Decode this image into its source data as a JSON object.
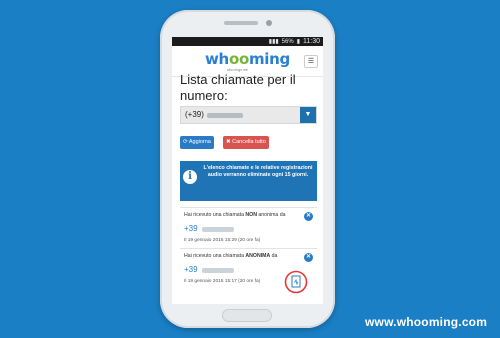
{
  "statusbar": {
    "battery": "56%",
    "time": "11:30"
  },
  "header": {
    "logo_text_1": "wh",
    "logo_text_2": "oo",
    "logo_text_3": "ming",
    "tagline": "who rings me",
    "menu_icon": "hamburger-icon"
  },
  "main": {
    "title": "Lista chiamate per il numero:",
    "phone_prefix": "(+39)",
    "dropdown_icon": "caret-down-icon",
    "update_label": "Aggiorna",
    "clear_label": "Cancella tutto",
    "info_text": "L'elenco chiamate e le relative registrazioni audio verranno eliminate ogni 15 giorni.",
    "calls": [
      {
        "headline": "Hai ricevuto una chiamata NON anonima da",
        "number_prefix": "+39",
        "date": "Il 19 gennaio 2015 15:29 (20 ore fa)"
      },
      {
        "headline": "Hai ricevuto una chiamata ANONIMA da",
        "number_prefix": "+39",
        "date": "Il 19 gennaio 2015 15:17 (20 ore fa)"
      }
    ]
  },
  "footer": {
    "brand": "www.whooming.com"
  },
  "colors": {
    "background": "#1a7fc4",
    "accent": "#2b7bc4",
    "danger": "#d9534f",
    "highlight": "#e53935"
  }
}
